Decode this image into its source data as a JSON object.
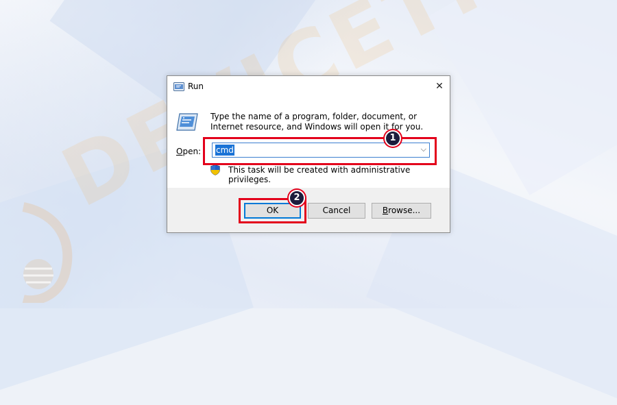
{
  "window": {
    "title": "Run",
    "close_glyph": "✕"
  },
  "body": {
    "description": "Type the name of a program, folder, document, or Internet resource, and Windows will open it for you.",
    "open_label_prefix": "O",
    "open_label_rest": "pen:",
    "open_value": "cmd",
    "dropdown_glyph": "⌵",
    "admin_note": "This task will be created with administrative privileges."
  },
  "buttons": {
    "ok": "OK",
    "cancel": "Cancel",
    "browse_prefix": "B",
    "browse_rest": "rowse..."
  },
  "annotations": {
    "step1": "1",
    "step2": "2",
    "highlight_color": "#e3001b"
  },
  "watermark": {
    "text": "DEVICETRICKS"
  },
  "icons": [
    "run-icon",
    "run-large-icon",
    "close-icon",
    "chevron-down-icon",
    "uac-shield-icon",
    "devicetricks-logo-icon"
  ]
}
